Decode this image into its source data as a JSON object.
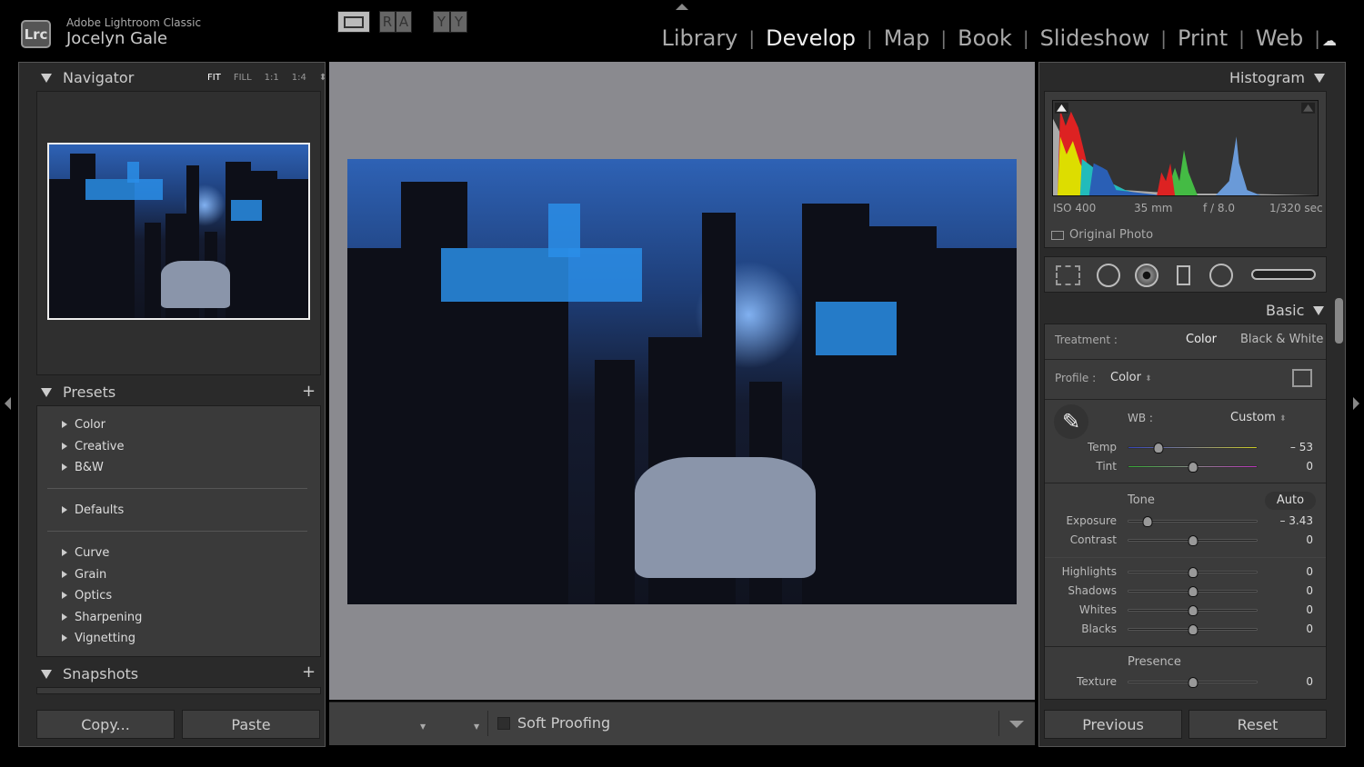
{
  "app": {
    "logo": "Lrc",
    "name": "Adobe Lightroom Classic",
    "user": "Jocelyn Gale"
  },
  "modules": [
    {
      "label": "Library",
      "active": false
    },
    {
      "label": "Develop",
      "active": true
    },
    {
      "label": "Map",
      "active": false
    },
    {
      "label": "Book",
      "active": false
    },
    {
      "label": "Slideshow",
      "active": false
    },
    {
      "label": "Print",
      "active": false
    },
    {
      "label": "Web",
      "active": false
    }
  ],
  "navigator": {
    "title": "Navigator",
    "zoom": [
      "FIT",
      "FILL",
      "1:1",
      "1:4"
    ],
    "active_zoom": "FIT"
  },
  "presets": {
    "title": "Presets",
    "groups": [
      [
        "Color",
        "Creative",
        "B&W"
      ],
      [
        "Defaults"
      ],
      [
        "Curve",
        "Grain",
        "Optics",
        "Sharpening",
        "Vignetting"
      ]
    ]
  },
  "snapshots": {
    "title": "Snapshots"
  },
  "left_buttons": {
    "copy": "Copy...",
    "paste": "Paste"
  },
  "toolbar": {
    "view_label_1": "R",
    "view_label_2": "A",
    "compare_1": "Y",
    "compare_2": "Y",
    "soft_proofing": "Soft Proofing"
  },
  "histogram": {
    "title": "Histogram",
    "iso": "ISO 400",
    "focal": "35 mm",
    "aperture": "f / 8.0",
    "shutter": "1/320 sec",
    "original_photo": "Original Photo"
  },
  "basic": {
    "title": "Basic",
    "treatment_label": "Treatment :",
    "treatment_color": "Color",
    "treatment_bw": "Black & White",
    "treatment_selected": "Color",
    "profile_label": "Profile :",
    "profile_value": "Color",
    "wb_label": "WB :",
    "wb_value": "Custom",
    "tone_label": "Tone",
    "auto_label": "Auto",
    "presence_label": "Presence",
    "sliders": [
      {
        "label": "Temp",
        "value": "– 53",
        "num": -53,
        "range": [
          -100,
          100
        ]
      },
      {
        "label": "Tint",
        "value": "0",
        "num": 0,
        "range": [
          -100,
          100
        ]
      },
      {
        "label": "Exposure",
        "value": "– 3.43",
        "num": -3.43,
        "range": [
          -5,
          5
        ]
      },
      {
        "label": "Contrast",
        "value": "0",
        "num": 0,
        "range": [
          -100,
          100
        ]
      },
      {
        "label": "Highlights",
        "value": "0",
        "num": 0,
        "range": [
          -100,
          100
        ]
      },
      {
        "label": "Shadows",
        "value": "0",
        "num": 0,
        "range": [
          -100,
          100
        ]
      },
      {
        "label": "Whites",
        "value": "0",
        "num": 0,
        "range": [
          -100,
          100
        ]
      },
      {
        "label": "Blacks",
        "value": "0",
        "num": 0,
        "range": [
          -100,
          100
        ]
      },
      {
        "label": "Texture",
        "value": "0",
        "num": 0,
        "range": [
          -100,
          100
        ]
      }
    ]
  },
  "right_buttons": {
    "previous": "Previous",
    "reset": "Reset"
  }
}
